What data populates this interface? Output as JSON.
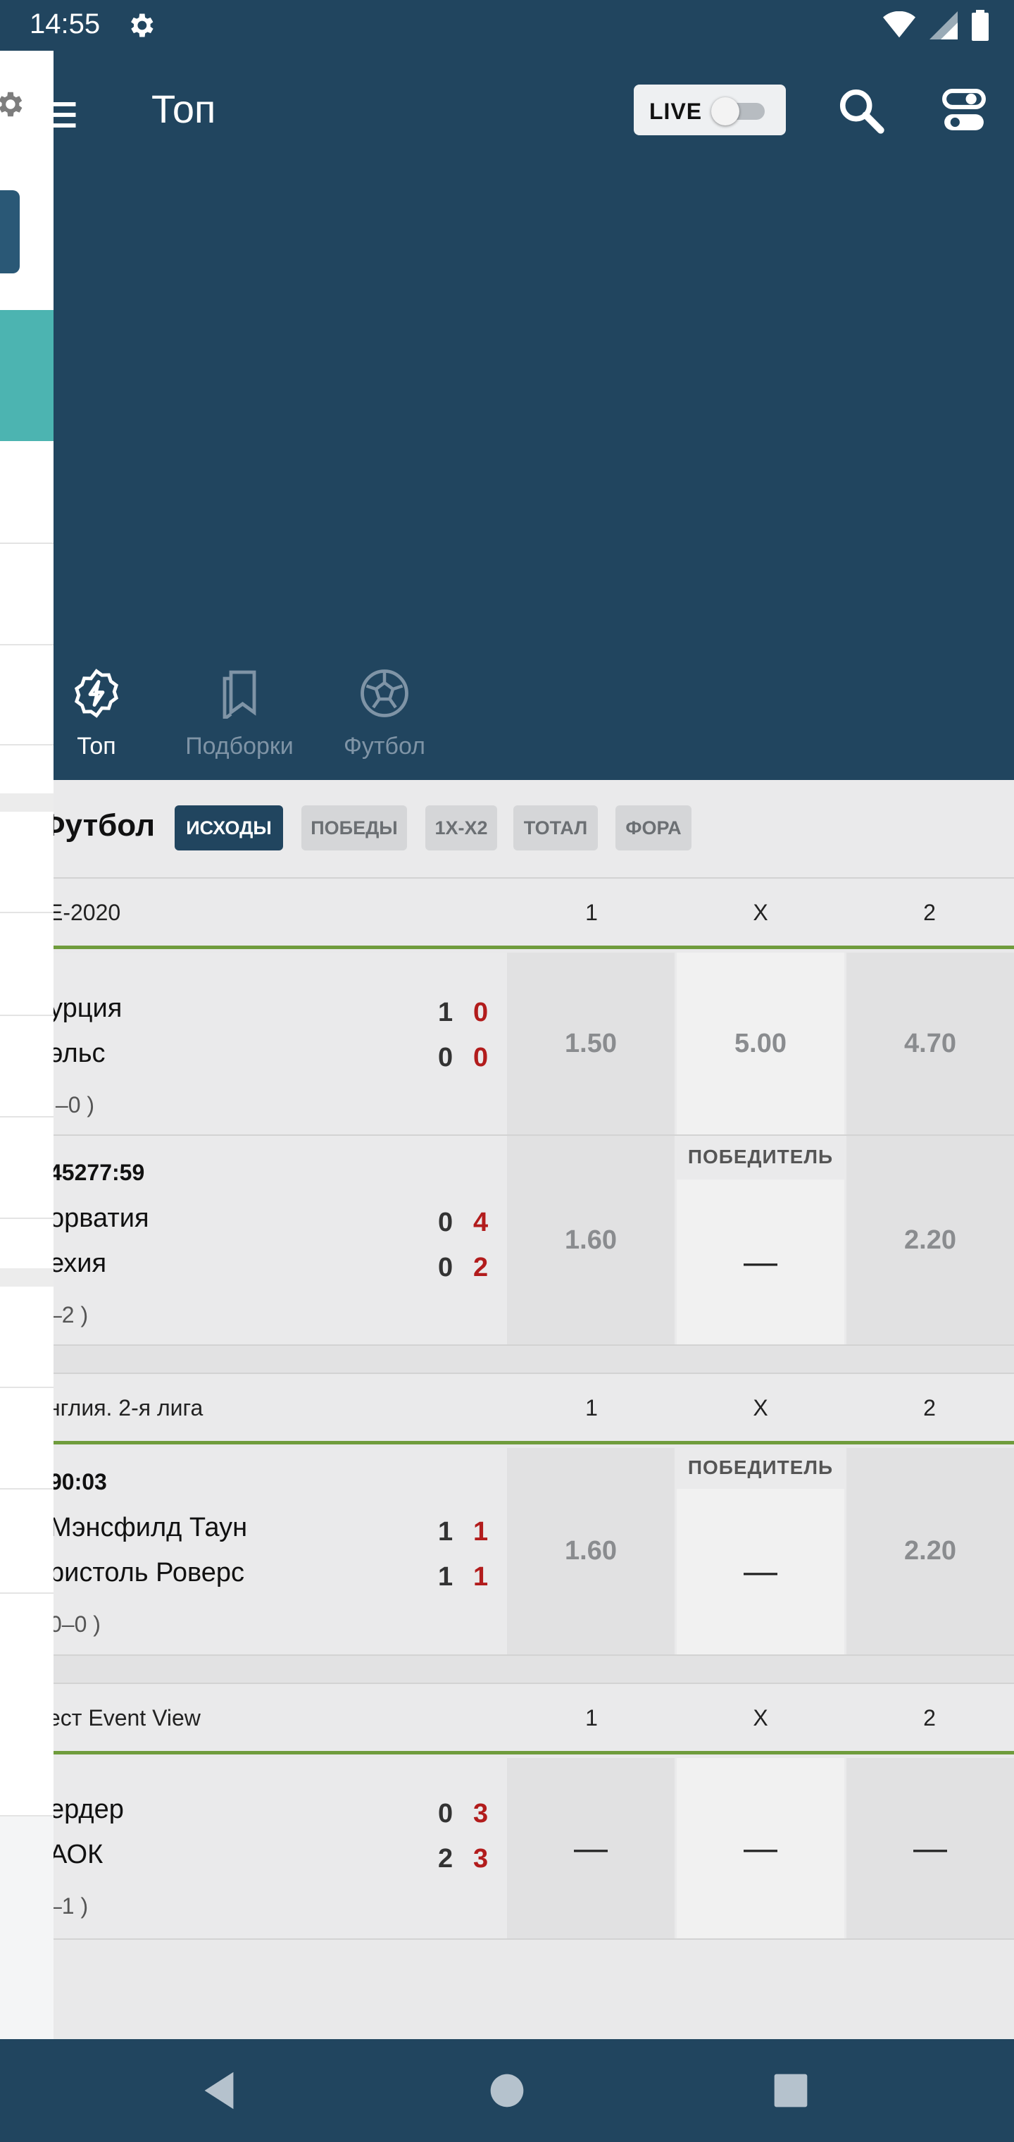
{
  "status_bar": {
    "time": "14:55"
  },
  "header": {
    "title": "Топ",
    "live_label": "LIVE"
  },
  "tabs": [
    {
      "label": "Топ",
      "icon": "lightning-badge-icon",
      "active": true
    },
    {
      "label": "Подборки",
      "icon": "bookmarks-icon",
      "active": false
    },
    {
      "label": "Футбол",
      "icon": "soccer-ball-icon",
      "active": false
    }
  ],
  "filter": {
    "sport_title": "Футбол",
    "chips": [
      "ИСХОДЫ",
      "ПОБЕДЫ",
      "1Х-Х2",
      "ТОТАЛ",
      "ФОРА"
    ],
    "active_chip": "ИСХОДЫ"
  },
  "columns": [
    "1",
    "X",
    "2"
  ],
  "leagues": [
    {
      "name": "Е-2020",
      "matches": [
        {
          "timer": "",
          "team1": "урция",
          "team2": "эльс",
          "score1_main": "1",
          "score1_sec": "0",
          "score2_main": "0",
          "score2_sec": "0",
          "period": ".–0 )",
          "odds": [
            "1.50",
            "5.00",
            "4.70"
          ],
          "winner_label": ""
        },
        {
          "timer": "45277:59",
          "team1": "орватия",
          "team2": "ехия",
          "score1_main": "0",
          "score1_sec": "4",
          "score2_main": "0",
          "score2_sec": "2",
          "period": "–2 )",
          "odds": [
            "1.60",
            "—",
            "2.20"
          ],
          "winner_label": "ПОБЕДИТЕЛЬ"
        }
      ]
    },
    {
      "name": "нглия. 2-я лига",
      "matches": [
        {
          "timer": " 90:03",
          "team1": "Мэнсфилд Таун",
          "team2": "ристоль Роверс",
          "score1_main": "1",
          "score1_sec": "1",
          "score2_main": "1",
          "score2_sec": "1",
          "period": "0–0 )",
          "odds": [
            "1.60",
            "—",
            "2.20"
          ],
          "winner_label": "ПОБЕДИТЕЛЬ"
        }
      ]
    },
    {
      "name": "ест Event View",
      "matches": [
        {
          "timer": "",
          "team1": "ердер",
          "team2": "АОК",
          "score1_main": "0",
          "score1_sec": "3",
          "score2_main": "2",
          "score2_sec": "3",
          "period": "–1 )",
          "odds": [
            "—",
            "—",
            "—"
          ],
          "winner_label": ""
        }
      ]
    }
  ],
  "colors": {
    "header_bg": "#21455f",
    "accent_green": "#6f9c3c",
    "score_red": "#b21c1c",
    "drawer_teal": "#4cb4b1"
  }
}
